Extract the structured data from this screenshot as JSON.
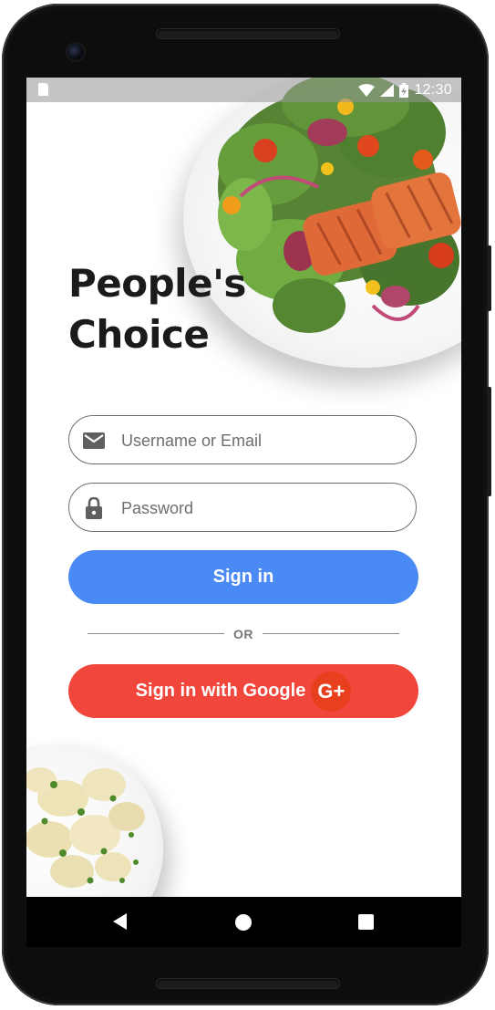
{
  "status_bar": {
    "time": "12:30",
    "icons": [
      "sd-card-icon",
      "wifi-icon",
      "signal-icon",
      "battery-charging-icon"
    ]
  },
  "app": {
    "title_line1": "People's",
    "title_line2": "Choice"
  },
  "login_form": {
    "username_placeholder": "Username or Email",
    "username_value": "",
    "username_icon": "mail-icon",
    "password_placeholder": "Password",
    "password_value": "",
    "password_icon": "lock-icon",
    "sign_in_label": "Sign in",
    "divider_label": "OR",
    "google_label": "Sign in with Google",
    "google_badge": "G+"
  },
  "nav_bar": {
    "items": [
      "back-icon",
      "home-icon",
      "recents-icon"
    ]
  },
  "colors": {
    "sign_in_button": "#4a8af4",
    "google_button": "#f0463b",
    "google_badge": "#e83f1f",
    "title_text": "#1b1b1b",
    "field_border": "#6f6f6f"
  }
}
